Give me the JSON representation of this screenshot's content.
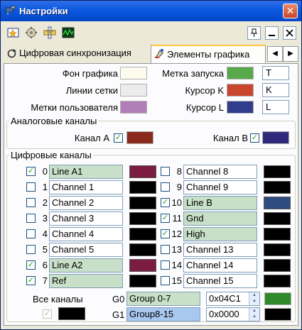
{
  "window": {
    "title": "Настройки",
    "close": "✕"
  },
  "tabs": [
    {
      "label": "Цифровая синхронизация",
      "active": false
    },
    {
      "label": "Элементы графика",
      "active": true
    }
  ],
  "scroll_arrows": {
    "left": "◀",
    "right": "▶"
  },
  "plot": {
    "background_label": "Фон графика",
    "grid_label": "Линии сетки",
    "user_markers_label": "Метки пользователя",
    "trigger_label": "Метка запуска",
    "trigger_text": "T",
    "cursor_k_label": "Курсор K",
    "cursor_k_text": "K",
    "cursor_l_label": "Курсор L",
    "cursor_l_text": "L",
    "colors": {
      "background": "#fcfbee",
      "grid": "#ececec",
      "user_markers": "#b07fb8",
      "trigger": "#58a84c",
      "cursor_k": "#c8462c",
      "cursor_l": "#303c8c"
    }
  },
  "analog": {
    "legend": "Аналоговые каналы",
    "a_label": "Канал A",
    "b_label": "Канал B",
    "a_checked": true,
    "b_checked": true,
    "a_color": "#8a2a1c",
    "b_color": "#30287c"
  },
  "digital": {
    "legend": "Цифровые каналы",
    "channels": [
      {
        "num": "0",
        "name": "Line A1",
        "checked": true,
        "highlight": "green",
        "color": "#7c1c40"
      },
      {
        "num": "1",
        "name": "Channel 1",
        "checked": false,
        "highlight": "",
        "color": "#000000"
      },
      {
        "num": "2",
        "name": "Channel 2",
        "checked": false,
        "highlight": "",
        "color": "#000000"
      },
      {
        "num": "3",
        "name": "Channel 3",
        "checked": false,
        "highlight": "",
        "color": "#000000"
      },
      {
        "num": "4",
        "name": "Channel 4",
        "checked": false,
        "highlight": "",
        "color": "#000000"
      },
      {
        "num": "5",
        "name": "Channel 5",
        "checked": false,
        "highlight": "",
        "color": "#000000"
      },
      {
        "num": "6",
        "name": "Line A2",
        "checked": true,
        "highlight": "green",
        "color": "#7c1c40"
      },
      {
        "num": "7",
        "name": "Ref",
        "checked": true,
        "highlight": "green",
        "color": "#000000"
      },
      {
        "num": "8",
        "name": "Channel 8",
        "checked": false,
        "highlight": "",
        "color": "#000000"
      },
      {
        "num": "9",
        "name": "Channel 9",
        "checked": false,
        "highlight": "",
        "color": "#000000"
      },
      {
        "num": "10",
        "name": "Line B",
        "checked": true,
        "highlight": "green",
        "color": "#2f4c80"
      },
      {
        "num": "11",
        "name": "Gnd",
        "checked": true,
        "highlight": "green",
        "color": "#000000"
      },
      {
        "num": "12",
        "name": "High",
        "checked": true,
        "highlight": "green",
        "color": "#000000"
      },
      {
        "num": "13",
        "name": "Channel 13",
        "checked": false,
        "highlight": "",
        "color": "#000000"
      },
      {
        "num": "14",
        "name": "Channel 14",
        "checked": false,
        "highlight": "",
        "color": "#000000"
      },
      {
        "num": "15",
        "name": "Channel 15",
        "checked": false,
        "highlight": "",
        "color": "#000000"
      }
    ],
    "all_channels_label": "Все каналы",
    "all_color": "#000000",
    "groups": [
      {
        "label": "G0",
        "name": "Group 0-7",
        "highlight": "green",
        "value": "0x04C1",
        "color": "#2f8a2c"
      },
      {
        "label": "G1",
        "name": "Group8-15",
        "highlight": "blue",
        "value": "0x0000",
        "color": "#000000"
      }
    ]
  }
}
